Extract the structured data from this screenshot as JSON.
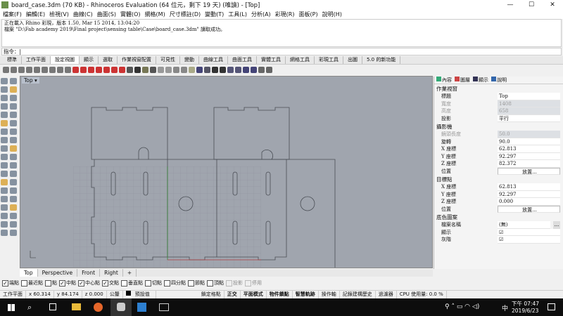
{
  "window": {
    "title": "board_case.3dm (70 KB) - Rhinoceros Evaluation (64 位元，剩下 19 天) (唯讀) - [Top]",
    "minimize": "—",
    "maximize": "☐",
    "close": "✕"
  },
  "menu": [
    "檔案(F)",
    "編輯(E)",
    "檢視(V)",
    "曲線(C)",
    "曲面(S)",
    "實體(O)",
    "網格(M)",
    "尺寸標註(D)",
    "變動(T)",
    "工具(L)",
    "分析(A)",
    "彩現(R)",
    "面板(P)",
    "說明(H)"
  ],
  "history": [
    "正在載入 Rhino 彩現，版本 1.50, Mar 15 2014, 13:04:20",
    "檔案 \"D:\\Fab academy 2019\\Final project\\sensing table\\Case\\board_case.3dm\" 讀取成功。"
  ],
  "command": {
    "label": "指令：",
    "value": "|"
  },
  "toolbar_tabs": [
    "標準",
    "工作平面",
    "設定視圖",
    "顯示",
    "選取",
    "作業視窗配置",
    "可見性",
    "變動",
    "曲線工具",
    "曲面工具",
    "實體工具",
    "網格工具",
    "彩現工具",
    "出圖",
    "5.0 的新功能"
  ],
  "active_toolbar_tab": 2,
  "viewport": {
    "label": "Top ▾",
    "tabs": [
      "Top",
      "Perspective",
      "Front",
      "Right",
      "+"
    ]
  },
  "osnaps": [
    {
      "label": "端點",
      "checked": true
    },
    {
      "label": "最近點",
      "checked": false
    },
    {
      "label": "點",
      "checked": false
    },
    {
      "label": "中點",
      "checked": true
    },
    {
      "label": "中心點",
      "checked": true
    },
    {
      "label": "交點",
      "checked": true
    },
    {
      "label": "垂直點",
      "checked": false
    },
    {
      "label": "切點",
      "checked": false
    },
    {
      "label": "四分點",
      "checked": false
    },
    {
      "label": "節點",
      "checked": false
    },
    {
      "label": "頂點",
      "checked": false
    },
    {
      "label": "投影",
      "checked": false,
      "disabled": true
    },
    {
      "label": "停用",
      "checked": false,
      "disabled": true
    }
  ],
  "status": {
    "cplane": "工作平面",
    "x": "x 60.314",
    "y": "y 84.174",
    "z": "z 0.000",
    "units": "公釐",
    "layer": "預設值",
    "items": [
      "鎖定格點",
      "正交",
      "平面模式",
      "物件鎖點",
      "智慧軌跡",
      "操作軸",
      "記錄建構歷史",
      "過濾器",
      "CPU 使用量: 0.0 %"
    ],
    "bold": [
      false,
      true,
      true,
      true,
      true,
      false,
      false,
      false,
      false
    ]
  },
  "panel": {
    "tabs": [
      "內容",
      "圖層",
      "顯示",
      "說明"
    ],
    "sections": [
      {
        "title": "作業視窗",
        "rows": [
          {
            "k": "標題",
            "v": "Top"
          },
          {
            "k": "寬度",
            "v": "1408",
            "disabled": true
          },
          {
            "k": "高度",
            "v": "658",
            "disabled": true
          },
          {
            "k": "投影",
            "v": "平行",
            "dropdown": true
          }
        ]
      },
      {
        "title": "攝影機",
        "rows": [
          {
            "k": "鏡頭長度",
            "v": "50.0",
            "disabled": true
          },
          {
            "k": "旋轉",
            "v": "90.0"
          },
          {
            "k": "X 座標",
            "v": "62.813"
          },
          {
            "k": "Y 座標",
            "v": "92.297"
          },
          {
            "k": "Z 座標",
            "v": "82.372"
          },
          {
            "k": "位置",
            "v": "放置...",
            "button": true
          }
        ]
      },
      {
        "title": "目標點",
        "rows": [
          {
            "k": "X 座標",
            "v": "62.813"
          },
          {
            "k": "Y 座標",
            "v": "92.297"
          },
          {
            "k": "Z 座標",
            "v": "0.000"
          },
          {
            "k": "位置",
            "v": "放置...",
            "button": true
          }
        ]
      },
      {
        "title": "底色圖案",
        "rows": [
          {
            "k": "檔案名稱",
            "v": "(無)",
            "more": "..."
          },
          {
            "k": "顯示",
            "v": "☑"
          },
          {
            "k": "灰階",
            "v": "☑"
          }
        ]
      }
    ]
  },
  "taskbar": {
    "time": "下午 07:47",
    "date": "2019/6/23",
    "ime": "中"
  }
}
